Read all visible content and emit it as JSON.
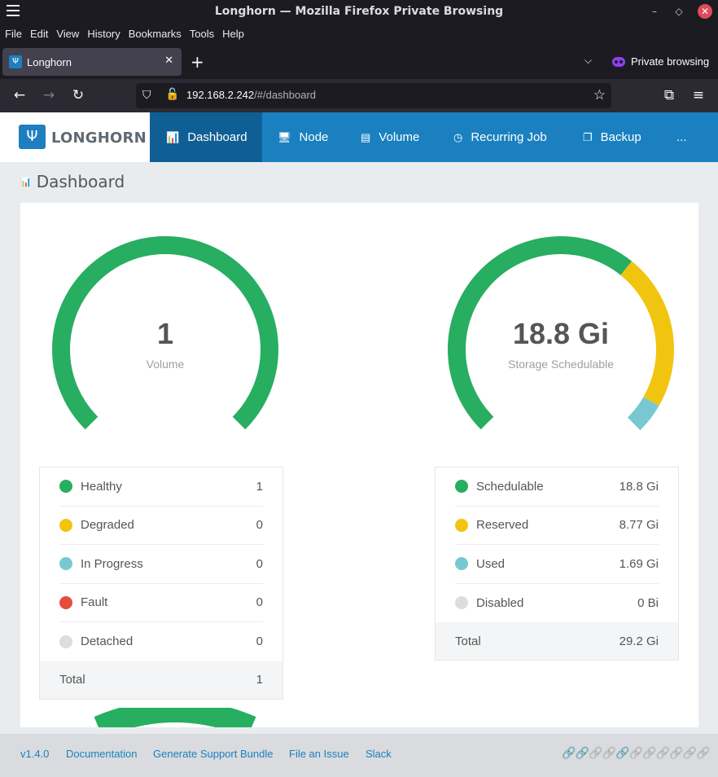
{
  "window": {
    "title": "Longhorn — Mozilla Firefox Private Browsing",
    "min": "–",
    "max": "◇",
    "close": "✕"
  },
  "menu": [
    "File",
    "Edit",
    "View",
    "History",
    "Bookmarks",
    "Tools",
    "Help"
  ],
  "tab": {
    "label": "Longhorn",
    "close": "✕"
  },
  "newtab": "+",
  "tablist": "⌵",
  "private_label": "Private browsing",
  "url": {
    "host": "192.168.2.242",
    "path": "/#/dashboard"
  },
  "logo": {
    "text": "LONGHORN"
  },
  "nav": [
    {
      "label": "Dashboard",
      "icon": "bar-chart-icon",
      "glyph": "📊"
    },
    {
      "label": "Node",
      "icon": "monitor-icon",
      "glyph": "🖥"
    },
    {
      "label": "Volume",
      "icon": "volume-icon",
      "glyph": "▤"
    },
    {
      "label": "Recurring Job",
      "icon": "clock-icon",
      "glyph": "◷"
    },
    {
      "label": "Backup",
      "icon": "copy-icon",
      "glyph": "❐"
    },
    {
      "label": "...",
      "icon": "",
      "glyph": ""
    }
  ],
  "page_title": "Dashboard",
  "volume_gauge": {
    "value": "1",
    "label": "Volume",
    "segments": [
      {
        "name": "Healthy",
        "fraction": 1.0,
        "color": "#27ae60"
      }
    ]
  },
  "volume_legend": [
    {
      "label": "Healthy",
      "value": "1",
      "color": "#27ae60"
    },
    {
      "label": "Degraded",
      "value": "0",
      "color": "#f1c40f"
    },
    {
      "label": "In Progress",
      "value": "0",
      "color": "#78c8d2"
    },
    {
      "label": "Fault",
      "value": "0",
      "color": "#e74c3c"
    },
    {
      "label": "Detached",
      "value": "0",
      "color": "#dddddd"
    }
  ],
  "volume_total": {
    "label": "Total",
    "value": "1"
  },
  "storage_gauge": {
    "value": "18.8 Gi",
    "label": "Storage Schedulable",
    "segments": [
      {
        "name": "Schedulable",
        "fraction": 0.6438,
        "color": "#27ae60"
      },
      {
        "name": "Reserved",
        "fraction": 0.3003,
        "color": "#f1c40f"
      },
      {
        "name": "Used",
        "fraction": 0.0579,
        "color": "#78c8d2"
      }
    ]
  },
  "storage_legend": [
    {
      "label": "Schedulable",
      "value": "18.8 Gi",
      "color": "#27ae60"
    },
    {
      "label": "Reserved",
      "value": "8.77 Gi",
      "color": "#f1c40f"
    },
    {
      "label": "Used",
      "value": "1.69 Gi",
      "color": "#78c8d2"
    },
    {
      "label": "Disabled",
      "value": "0 Bi",
      "color": "#dddddd"
    }
  ],
  "storage_total": {
    "label": "Total",
    "value": "29.2 Gi"
  },
  "footer": {
    "version": "v1.4.0",
    "documentation": "Documentation",
    "support_bundle": "Generate Support Bundle",
    "issue": "File an Issue",
    "slack": "Slack"
  },
  "connection_links": [
    "green",
    "green",
    "gray",
    "gray",
    "green",
    "gray",
    "gray",
    "gray",
    "gray",
    "gray",
    "gray"
  ]
}
